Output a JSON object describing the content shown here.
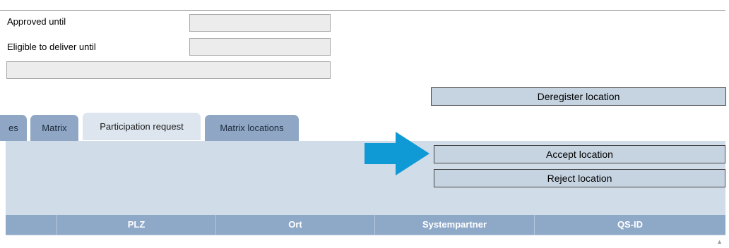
{
  "form": {
    "approved_until_label": "Approved until",
    "approved_until_value": "",
    "eligible_label": "Eligible to deliver until",
    "eligible_value": "",
    "wide_field_value": ""
  },
  "buttons": {
    "deregister": "Deregister location",
    "accept": "Accept location",
    "reject": "Reject location"
  },
  "tabs": [
    {
      "label": "es",
      "active": false
    },
    {
      "label": "Matrix",
      "active": false
    },
    {
      "label": "Participation request",
      "active": true
    },
    {
      "label": "Matrix locations",
      "active": false
    }
  ],
  "table": {
    "columns": [
      "",
      "PLZ",
      "Ort",
      "Systempartner",
      "QS-ID"
    ]
  },
  "colors": {
    "arrow": "#0f9ad6",
    "panel": "#d0dce7",
    "button": "#c6d4e2",
    "tab_inactive": "#8fa7c5",
    "header": "#8ea8c8"
  },
  "icons": {
    "pointer_arrow": "right-arrow-icon",
    "scroll_up": "scroll-up-icon"
  }
}
